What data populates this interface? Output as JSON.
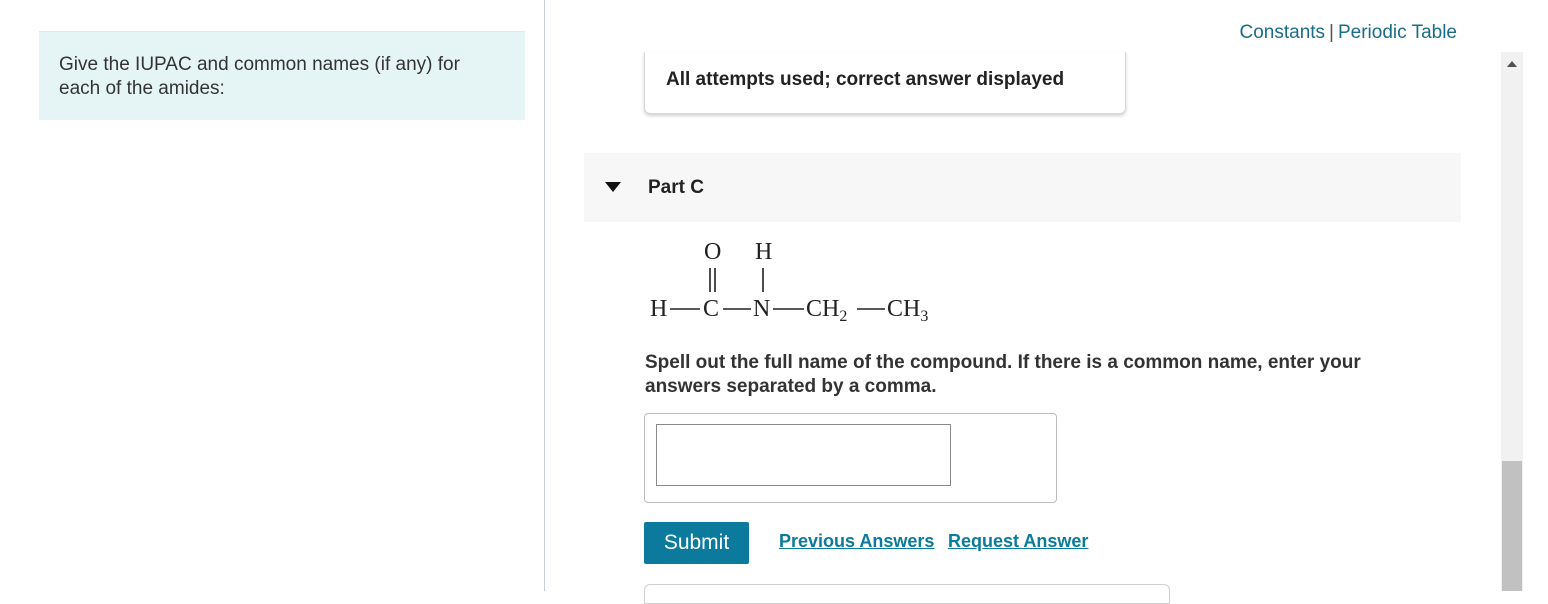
{
  "prompt": {
    "text": "Give the IUPAC and common names (if any) for each of the amides:"
  },
  "top_links": {
    "constants": "Constants",
    "separator": "|",
    "periodic_table": "Periodic Table",
    "link_color": "#1b6b8a"
  },
  "status": {
    "message": "All attempts used; correct answer displayed"
  },
  "part": {
    "title": "Part C",
    "expanded": true
  },
  "molecule": {
    "oxygen": "O",
    "top_hydrogen": "H",
    "left_hydrogen": "H",
    "carbon": "C",
    "nitrogen": "N",
    "ch2": "CH",
    "ch2_sub": "2",
    "ch3": "CH",
    "ch3_sub": "3"
  },
  "instruction": {
    "text": "Spell out the full name of the compound. If there is a common name, enter your answers separated by a comma."
  },
  "answer": {
    "value": "",
    "placeholder": ""
  },
  "actions": {
    "submit": "Submit",
    "previous_answers": "Previous Answers",
    "request_answer": "Request Answer",
    "accent_color": "#0b7a9c"
  },
  "icons": {
    "caret": "caret-down-icon",
    "scroll_up": "scroll-up-arrow-icon"
  }
}
